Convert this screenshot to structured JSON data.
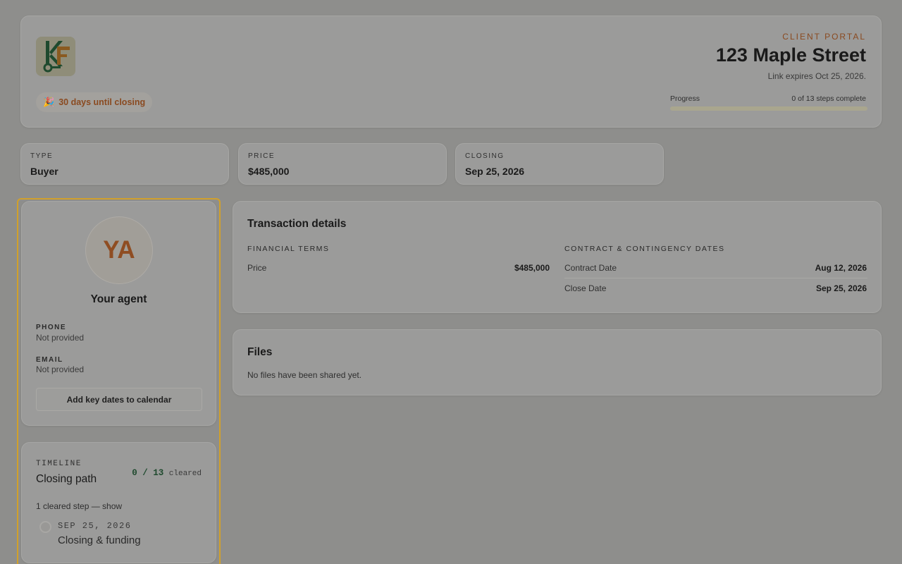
{
  "header": {
    "portal_label": "CLIENT PORTAL",
    "address": "123 Maple Street",
    "expires": "Link expires Oct 25, 2026.",
    "closing_badge": "30 days until closing",
    "closing_badge_icon": "party-popper-icon",
    "progress": {
      "label": "Progress",
      "count_text": "0 of 13 steps complete",
      "completed": 0,
      "total": 13
    }
  },
  "summary": [
    {
      "label": "TYPE",
      "value": "Buyer"
    },
    {
      "label": "PRICE",
      "value": "$485,000"
    },
    {
      "label": "CLOSING",
      "value": "Sep 25, 2026"
    }
  ],
  "agent": {
    "initials": "YA",
    "title": "Your agent",
    "phone_label": "PHONE",
    "phone_value": "Not provided",
    "email_label": "EMAIL",
    "email_value": "Not provided",
    "calendar_button": "Add key dates to calendar"
  },
  "timeline": {
    "label": "TIMELINE",
    "title": "Closing path",
    "count": "0 / 13",
    "count_unit": "cleared",
    "toggle_text": "1 cleared step — show",
    "steps": [
      {
        "date": "SEP 25, 2026",
        "name": "Closing & funding"
      }
    ]
  },
  "details": {
    "title": "Transaction details",
    "financial_heading": "FINANCIAL TERMS",
    "financial_rows": [
      {
        "label": "Price",
        "value": "$485,000"
      }
    ],
    "dates_heading": "CONTRACT & CONTINGENCY DATES",
    "date_rows": [
      {
        "label": "Contract Date",
        "value": "Aug 12, 2026"
      },
      {
        "label": "Close Date",
        "value": "Sep 25, 2026"
      }
    ]
  },
  "files": {
    "title": "Files",
    "empty_text": "No files have been shared yet."
  },
  "colors": {
    "accent": "#8a4a20",
    "highlight_border": "#d1a02b",
    "logo_green": "#1f4a2e"
  }
}
